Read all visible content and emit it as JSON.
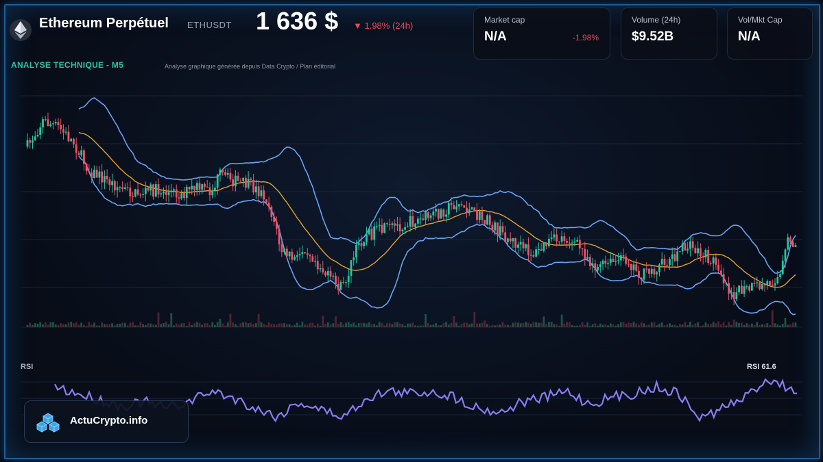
{
  "header": {
    "title": "Ethereum Perpétuel",
    "symbol": "ETHUSDT",
    "price": "1 636 $",
    "change": "▼ 1.98% (24h)"
  },
  "stats": [
    {
      "label": "Market cap",
      "value": "N/A",
      "extra": "-1.98%"
    },
    {
      "label": "Volume (24h)",
      "value": "$9.52B"
    },
    {
      "label": "Vol/Mkt Cap",
      "value": "N/A"
    }
  ],
  "analysis": {
    "title": "ANALYSE TECHNIQUE - M5",
    "subtitle": "Analyse graphique générée depuis Data Crypto / Plan éditorial"
  },
  "rsi": {
    "label": "RSI",
    "value_text": "RSI 61.6"
  },
  "brand": {
    "name": "ActuCrypto.info",
    "icon": "cubes-logo-icon"
  },
  "colors": {
    "up": "#26c6a0",
    "down": "#ef5366",
    "bollinger": "#6aa2f2",
    "ma": "#e5a12a",
    "rsi": "#8b7cf0",
    "accent": "#2ec4a4"
  },
  "chart_data": {
    "type": "candlestick",
    "indicators": [
      "bollinger-bands",
      "moving-average",
      "volume",
      "rsi"
    ],
    "close_path": [
      [
        0,
        0.22
      ],
      [
        0.02,
        0.1
      ],
      [
        0.04,
        0.13
      ],
      [
        0.06,
        0.2
      ],
      [
        0.08,
        0.33
      ],
      [
        0.1,
        0.37
      ],
      [
        0.12,
        0.41
      ],
      [
        0.14,
        0.44
      ],
      [
        0.16,
        0.42
      ],
      [
        0.18,
        0.43
      ],
      [
        0.2,
        0.44
      ],
      [
        0.22,
        0.41
      ],
      [
        0.24,
        0.43
      ],
      [
        0.25,
        0.35
      ],
      [
        0.27,
        0.38
      ],
      [
        0.29,
        0.4
      ],
      [
        0.31,
        0.45
      ],
      [
        0.32,
        0.55
      ],
      [
        0.33,
        0.7
      ],
      [
        0.35,
        0.75
      ],
      [
        0.36,
        0.68
      ],
      [
        0.37,
        0.72
      ],
      [
        0.38,
        0.77
      ],
      [
        0.39,
        0.82
      ],
      [
        0.4,
        0.85
      ],
      [
        0.41,
        0.88
      ],
      [
        0.42,
        0.78
      ],
      [
        0.43,
        0.68
      ],
      [
        0.44,
        0.63
      ],
      [
        0.46,
        0.61
      ],
      [
        0.48,
        0.59
      ],
      [
        0.5,
        0.57
      ],
      [
        0.52,
        0.55
      ],
      [
        0.54,
        0.52
      ],
      [
        0.56,
        0.48
      ],
      [
        0.58,
        0.53
      ],
      [
        0.6,
        0.57
      ],
      [
        0.62,
        0.63
      ],
      [
        0.64,
        0.68
      ],
      [
        0.66,
        0.72
      ],
      [
        0.68,
        0.66
      ],
      [
        0.7,
        0.64
      ],
      [
        0.72,
        0.69
      ],
      [
        0.74,
        0.78
      ],
      [
        0.76,
        0.76
      ],
      [
        0.78,
        0.74
      ],
      [
        0.8,
        0.82
      ],
      [
        0.82,
        0.78
      ],
      [
        0.84,
        0.73
      ],
      [
        0.86,
        0.68
      ],
      [
        0.88,
        0.72
      ],
      [
        0.9,
        0.77
      ],
      [
        0.91,
        0.86
      ],
      [
        0.92,
        0.9
      ],
      [
        0.94,
        0.88
      ],
      [
        0.96,
        0.86
      ],
      [
        0.97,
        0.84
      ],
      [
        0.98,
        0.82
      ],
      [
        0.99,
        0.66
      ],
      [
        1.0,
        0.67
      ]
    ],
    "rsi_path": [
      [
        0,
        0.2
      ],
      [
        0.03,
        0.35
      ],
      [
        0.06,
        0.5
      ],
      [
        0.09,
        0.65
      ],
      [
        0.12,
        0.55
      ],
      [
        0.15,
        0.7
      ],
      [
        0.18,
        0.55
      ],
      [
        0.21,
        0.3
      ],
      [
        0.24,
        0.45
      ],
      [
        0.27,
        0.7
      ],
      [
        0.3,
        0.9
      ],
      [
        0.33,
        0.55
      ],
      [
        0.36,
        0.75
      ],
      [
        0.39,
        0.9
      ],
      [
        0.42,
        0.45
      ],
      [
        0.45,
        0.3
      ],
      [
        0.48,
        0.35
      ],
      [
        0.51,
        0.3
      ],
      [
        0.54,
        0.45
      ],
      [
        0.57,
        0.7
      ],
      [
        0.6,
        0.8
      ],
      [
        0.63,
        0.55
      ],
      [
        0.66,
        0.45
      ],
      [
        0.69,
        0.3
      ],
      [
        0.72,
        0.6
      ],
      [
        0.75,
        0.45
      ],
      [
        0.78,
        0.35
      ],
      [
        0.81,
        0.2
      ],
      [
        0.84,
        0.35
      ],
      [
        0.87,
        0.95
      ],
      [
        0.9,
        0.7
      ],
      [
        0.93,
        0.45
      ],
      [
        0.96,
        0.0
      ],
      [
        1.0,
        0.3
      ]
    ],
    "last_rsi": 61.6
  }
}
